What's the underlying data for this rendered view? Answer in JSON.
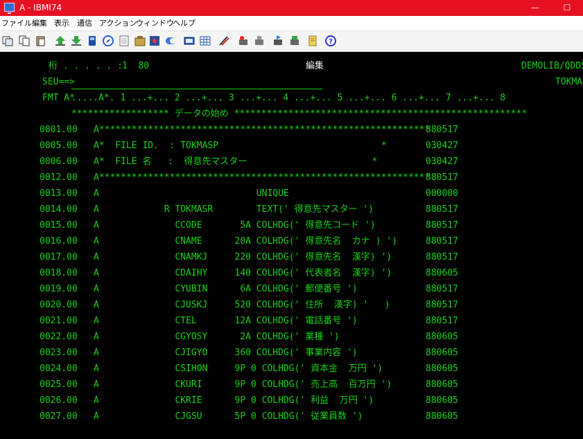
{
  "window": {
    "title": "A - IBMI74",
    "minimize": "—",
    "maximize": "☐"
  },
  "menu": [
    "ファイル",
    "編集",
    "表示",
    "通信",
    "アクション",
    "ウィンドウ",
    "ヘルプ"
  ],
  "toolbar_icons": [
    "copy-screen-icon",
    "copy-icon",
    "paste-icon",
    "send-icon",
    "receive-icon",
    "printer-icon",
    "browser-icon",
    "notes-icon",
    "macro-icon",
    "settings-icon",
    "toggle-icon",
    "keypad-icon",
    "record-icon",
    "script-icon",
    "run-icon",
    "stop-icon",
    "play-icon",
    "transfer-icon",
    "document-icon",
    "help-icon"
  ],
  "terminal": {
    "header": {
      "col_label": "桁 . . . . . :",
      "col_range": "1  80",
      "mode": "編集",
      "member_path": "DEMOLIB/QDDSSRC",
      "seu_prompt": "SEU==>",
      "member_name": "TOKMASP",
      "fmt_label": "FMT A*",
      "ruler": ".....A*. 1 ...+... 2 ...+... 3 ...+... 4 ...+... 5 ...+... 6 ...+... 7 ...+... 8",
      "top_of_data": "****************** データの始め ******************************************************"
    },
    "lines": [
      {
        "seq": "0001.00",
        "src": "A*************************************************************",
        "date": "880517"
      },
      {
        "seq": "0005.00",
        "src": "A*  FILE ID.  : TOKMASP                              *",
        "date": "030427"
      },
      {
        "seq": "0006.00",
        "src": "A*  FILE 名   :  得意先マスター                       *",
        "date": "030427"
      },
      {
        "seq": "0012.00",
        "src": "A*************************************************************",
        "date": "880517"
      },
      {
        "seq": "0013.00",
        "src": "A                             UNIQUE",
        "date": "000000"
      },
      {
        "seq": "0014.00",
        "src": "A            R TOKMASR        TEXT(' 得意先マスター ')",
        "date": "880517"
      },
      {
        "seq": "0015.00",
        "src": "A              CCODE       5A COLHDG(' 得意先コード ')",
        "date": "880517"
      },
      {
        "seq": "0016.00",
        "src": "A              CNAME      20A COLHDG(' 得意先名  カナ ) ')",
        "date": "880517"
      },
      {
        "seq": "0017.00",
        "src": "A              CNAMKJ     220 COLHDG(' 得意先名  漢字) ')",
        "date": "880517"
      },
      {
        "seq": "0018.00",
        "src": "A              CDAIHY     140 COLHDG(' 代表者名  漢字) ')",
        "date": "880605"
      },
      {
        "seq": "0019.00",
        "src": "A              CYUBIN      6A COLHDG(' 郵便番号 ')",
        "date": "880517"
      },
      {
        "seq": "0020.00",
        "src": "A              CJUSKJ     520 COLHDG(' 住所  漢字) '   )",
        "date": "880517"
      },
      {
        "seq": "0021.00",
        "src": "A              CTEL       12A COLHDG(' 電話番号 ')",
        "date": "880517"
      },
      {
        "seq": "0022.00",
        "src": "A              CGYOSY      2A COLHDG(' 業種 ')",
        "date": "880605"
      },
      {
        "seq": "0023.00",
        "src": "A              CJIGYO     360 COLHDG(' 事業内容 ')",
        "date": "880605"
      },
      {
        "seq": "0024.00",
        "src": "A              CSIHON     9P 0 COLHDG(' 資本金  万円 ')",
        "date": "880605"
      },
      {
        "seq": "0025.00",
        "src": "A              CKURI      9P 0 COLHDG(' 売上高  百万円 ')",
        "date": "880605"
      },
      {
        "seq": "0026.00",
        "src": "A              CKRIE      9P 0 COLHDG(' 利益  万円 ')",
        "date": "880605"
      },
      {
        "seq": "0027.00",
        "src": "A              CJGSU      5P 0 COLHDG(' 従業員数 ')",
        "date": "880605"
      }
    ]
  }
}
